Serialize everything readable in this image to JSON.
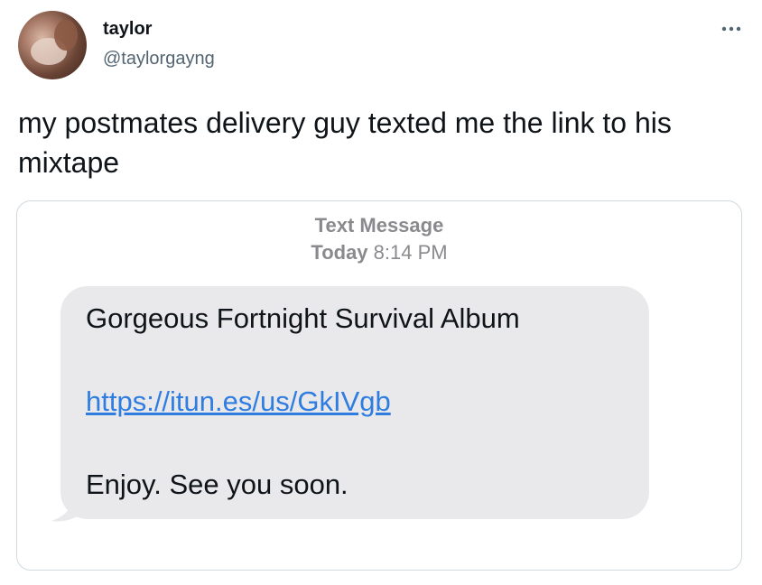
{
  "tweet": {
    "display_name": "taylor",
    "handle": "@taylorgayng",
    "text": "my postmates delivery guy texted me the link to his mixtape",
    "more_icon": "more-horizontal-icon"
  },
  "message_screenshot": {
    "service": "Text Message",
    "day": "Today",
    "time": "8:14 PM",
    "lines": [
      "Gorgeous Fortnight Survival Album",
      "https://itun.es/us/GkIVgb",
      "Enjoy. See you soon."
    ]
  },
  "colors": {
    "bubble": "#e9e9eb",
    "link": "#2f7de1",
    "secondary_text": "#536471",
    "header_text": "#8a8a8e"
  }
}
